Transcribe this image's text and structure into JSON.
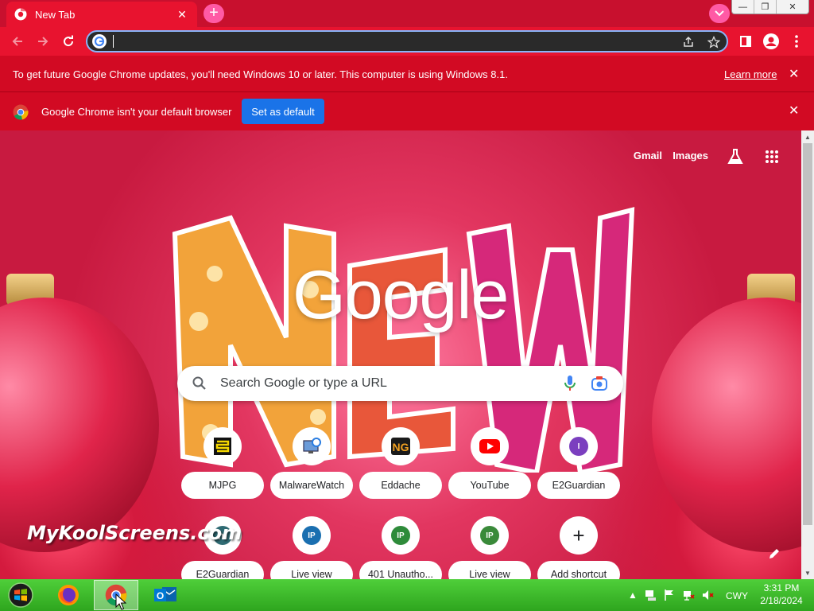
{
  "tab": {
    "title": "New Tab",
    "close": "✕"
  },
  "newtab": {
    "label": "+"
  },
  "window_controls": {
    "minimize": "—",
    "maximize": "❐",
    "close": "✕"
  },
  "omnibox": {
    "value": ""
  },
  "infobars": {
    "update": {
      "message": "To get future Google Chrome updates, you'll need Windows 10 or later. This computer is using Windows 8.1.",
      "link": "Learn more",
      "close": "✕"
    },
    "default_browser": {
      "message": "Google Chrome isn't your default browser",
      "button": "Set as default",
      "close": "✕"
    }
  },
  "ntp": {
    "links": {
      "gmail": "Gmail",
      "images": "Images"
    },
    "logo": "Google",
    "search": {
      "placeholder": "Search Google or type a URL"
    },
    "shortcuts": [
      {
        "label": "MJPG",
        "icon": "mjpg-icon"
      },
      {
        "label": "MalwareWatch",
        "icon": "malwarewatch-icon"
      },
      {
        "label": "Eddache",
        "icon": "eddache-icon"
      },
      {
        "label": "YouTube",
        "icon": "youtube-icon"
      },
      {
        "label": "E2Guardian",
        "icon": "e2guardian-icon",
        "letter": "I"
      },
      {
        "label": "E2Guardian",
        "icon": "e2guardian-m-icon",
        "letter": "m"
      },
      {
        "label": "Live view",
        "icon": "ip-icon",
        "letter": "IP"
      },
      {
        "label": "401 Unautho...",
        "icon": "ip-icon",
        "letter": "IP"
      },
      {
        "label": "Live view",
        "icon": "ip-icon",
        "letter": "IP"
      },
      {
        "label": "Add shortcut",
        "icon": "plus-icon",
        "letter": "+"
      }
    ],
    "watermark": "MyKoolScreens.com"
  },
  "taskbar": {
    "language": "CWY",
    "time": "3:31 PM",
    "date": "2/18/2024"
  },
  "colors": {
    "accent": "#e8132f",
    "infobar": "#d20a23",
    "button_blue": "#1a73e8",
    "taskbar": "#3cba28"
  }
}
